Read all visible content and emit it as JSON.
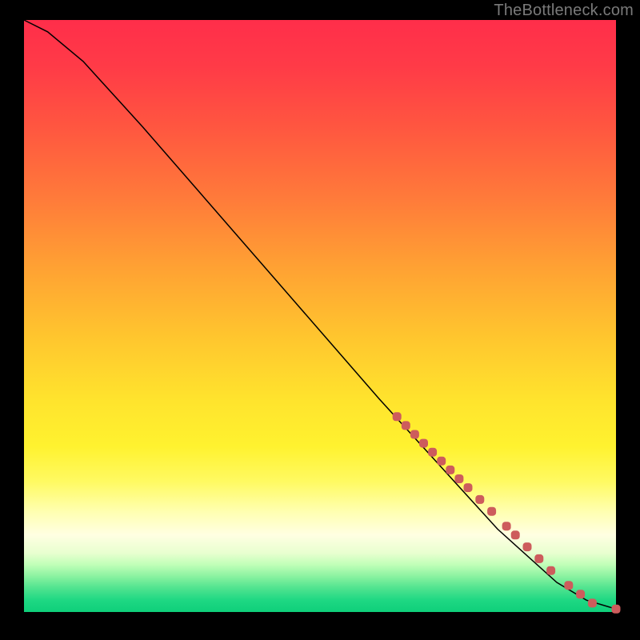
{
  "attribution": "TheBottleneck.com",
  "chart_data": {
    "type": "line",
    "title": "",
    "xlabel": "",
    "ylabel": "",
    "xlim": [
      0,
      100
    ],
    "ylim": [
      0,
      100
    ],
    "background_gradient": {
      "direction": "vertical",
      "stops": [
        {
          "pct": 0,
          "color": "#ff2e4a"
        },
        {
          "pct": 50,
          "color": "#ffd12d"
        },
        {
          "pct": 85,
          "color": "#ffffe0"
        },
        {
          "pct": 100,
          "color": "#0fcf7a"
        }
      ]
    },
    "series": [
      {
        "name": "bottleneck-curve",
        "x": [
          0,
          4,
          10,
          20,
          30,
          40,
          50,
          60,
          70,
          80,
          90,
          95,
          100
        ],
        "y": [
          100,
          98,
          93,
          82,
          70.5,
          59,
          47.5,
          36,
          25,
          14,
          5,
          2,
          0.5
        ]
      }
    ],
    "highlight_points": {
      "name": "highlighted-range",
      "note": "salmon data markers clustered on lower-right portion of curve",
      "points": [
        {
          "x": 63,
          "y": 33
        },
        {
          "x": 64.5,
          "y": 31.5
        },
        {
          "x": 66,
          "y": 30
        },
        {
          "x": 67.5,
          "y": 28.5
        },
        {
          "x": 69,
          "y": 27
        },
        {
          "x": 70.5,
          "y": 25.5
        },
        {
          "x": 72,
          "y": 24
        },
        {
          "x": 73.5,
          "y": 22.5
        },
        {
          "x": 75,
          "y": 21
        },
        {
          "x": 77,
          "y": 19
        },
        {
          "x": 79,
          "y": 17
        },
        {
          "x": 81.5,
          "y": 14.5
        },
        {
          "x": 83,
          "y": 13
        },
        {
          "x": 85,
          "y": 11
        },
        {
          "x": 87,
          "y": 9
        },
        {
          "x": 89,
          "y": 7
        },
        {
          "x": 92,
          "y": 4.5
        },
        {
          "x": 94,
          "y": 3
        },
        {
          "x": 96,
          "y": 1.5
        },
        {
          "x": 100,
          "y": 0.5
        }
      ]
    }
  }
}
